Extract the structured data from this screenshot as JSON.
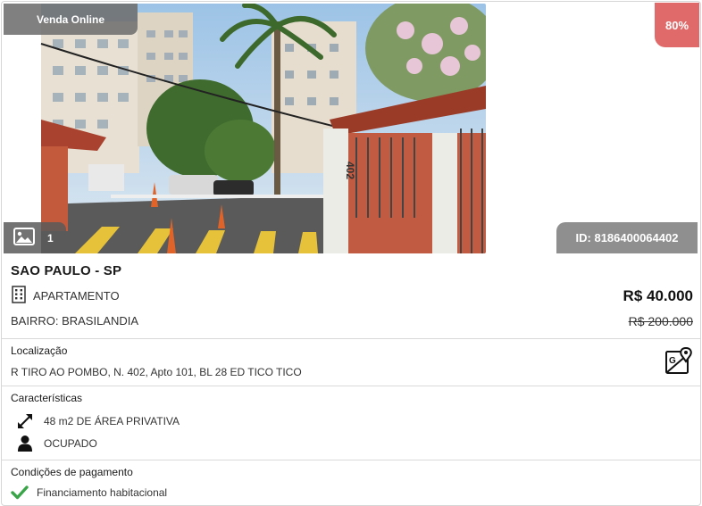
{
  "badges": {
    "sale_type": "Venda Online",
    "discount": "80%",
    "photo_count": "1",
    "id_label": "ID: 8186400064402"
  },
  "property": {
    "city": "SAO PAULO - SP",
    "type": "APARTAMENTO",
    "neighborhood": "BAIRRO: BRASILANDIA",
    "price": "R$ 40.000",
    "old_price": "R$ 200.000"
  },
  "location": {
    "title": "Localização",
    "address": "R TIRO AO POMBO, N. 402, Apto 101, BL 28 ED TICO TICO"
  },
  "features": {
    "title": "Características",
    "area": "48 m2 DE ÁREA PRIVATIVA",
    "occupancy": "OCUPADO"
  },
  "payment": {
    "title": "Condições de pagamento",
    "option": "Financiamento habitacional"
  },
  "photo": {
    "number_plate": "402"
  },
  "colors": {
    "discount_bg": "#e06a6a",
    "check_green": "#3aa548",
    "badge_gray": "#8f8f8f"
  }
}
